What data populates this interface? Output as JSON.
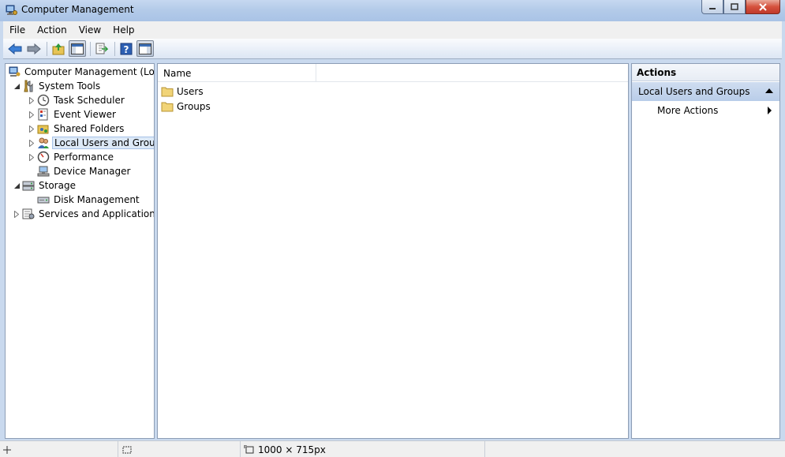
{
  "window": {
    "title": "Computer Management"
  },
  "menu": {
    "file": "File",
    "action": "Action",
    "view": "View",
    "help": "Help"
  },
  "tree": {
    "root": "Computer Management (Local",
    "system_tools": "System Tools",
    "task_scheduler": "Task Scheduler",
    "event_viewer": "Event Viewer",
    "shared_folders": "Shared Folders",
    "local_users_groups": "Local Users and Groups",
    "performance": "Performance",
    "device_manager": "Device Manager",
    "storage": "Storage",
    "disk_management": "Disk Management",
    "services_apps": "Services and Applications"
  },
  "list": {
    "column_name": "Name",
    "items": [
      "Users",
      "Groups"
    ]
  },
  "actions": {
    "title": "Actions",
    "group": "Local Users and Groups",
    "more": "More Actions"
  },
  "status": {
    "size": "1000 × 715px"
  },
  "colors": {
    "selection": "#dde9f7",
    "title_bar": "#b4cbe9",
    "actions_group": "#c4d6ee"
  }
}
